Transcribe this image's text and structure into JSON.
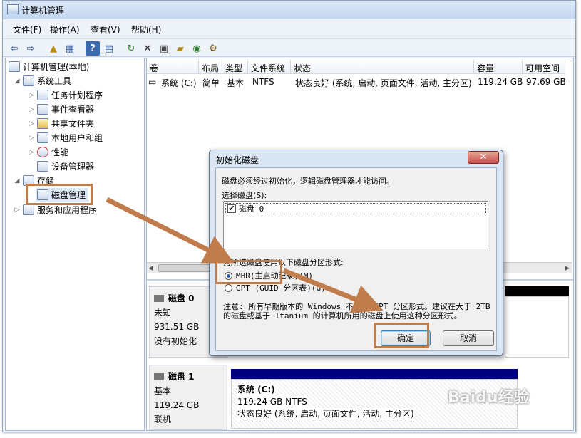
{
  "window": {
    "title": "计算机管理"
  },
  "menu": [
    "文件(F)",
    "操作(A)",
    "查看(V)",
    "帮助(H)"
  ],
  "toolbar_icons": [
    "back-icon",
    "forward-icon",
    "up-folder-icon",
    "show-tree-icon",
    "help-icon",
    "action-pane-icon",
    "refresh-icon",
    "delete-icon",
    "properties-icon",
    "open-icon",
    "find-icon",
    "settings-icon"
  ],
  "tree": {
    "root": "计算机管理(本地)",
    "system_tools": "系统工具",
    "task_scheduler": "任务计划程序",
    "event_viewer": "事件查看器",
    "shared_folders": "共享文件夹",
    "local_users": "本地用户和组",
    "performance": "性能",
    "device_manager": "设备管理器",
    "storage": "存储",
    "disk_management": "磁盘管理",
    "services": "服务和应用程序"
  },
  "volume_table": {
    "headers": [
      "卷",
      "布局",
      "类型",
      "文件系统",
      "状态",
      "容量",
      "可用空间"
    ],
    "rows": [
      [
        "系统 (C:)",
        "简单",
        "基本",
        "NTFS",
        "状态良好 (系统, 启动, 页面文件, 活动, 主分区)",
        "119.24 GB",
        "97.69 GB"
      ]
    ]
  },
  "disks": [
    {
      "name": "磁盘 0",
      "type": "未知",
      "size": "931.51 GB",
      "status": "没有初始化"
    },
    {
      "name": "磁盘 1",
      "type": "基本",
      "size": "119.24 GB",
      "status": "联机"
    }
  ],
  "partition": {
    "name": "系统 (C:)",
    "size": "119.24 GB NTFS",
    "status": "状态良好 (系统, 启动, 页面文件, 活动, 主分区)"
  },
  "dialog": {
    "title": "初始化磁盘",
    "close": "✕",
    "intro": "磁盘必须经过初始化，逻辑磁盘管理器才能访问。",
    "select_label": "选择磁盘(S):",
    "disk_item": "磁盘 0",
    "style_label": "为所选磁盘使用以下磁盘分区形式:",
    "mbr": "MBR(主启动记录)(M)",
    "gpt": "GPT (GUID 分区表)(G)",
    "note": "注意: 所有早期版本的 Windows 不识别 GPT 分区形式。建议在大于 2TB 的磁盘或基于 Itanium 的计算机所用的磁盘上使用这种分区形式。",
    "ok": "确定",
    "cancel": "取消"
  },
  "watermark": "Baidu经验",
  "colors": {
    "accent_orange": "#c07d4b",
    "partition_bar": "#00007f"
  }
}
